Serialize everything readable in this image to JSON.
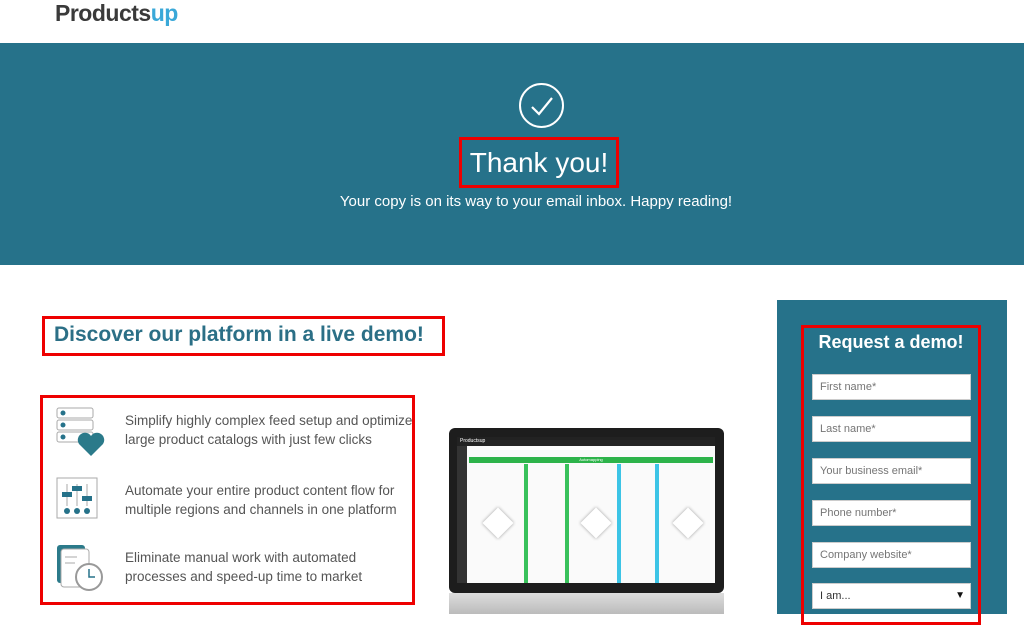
{
  "header": {
    "logo_main": "Products",
    "logo_accent": "up"
  },
  "hero": {
    "icon": "check-circle-icon",
    "title": "Thank you!",
    "subtitle": "Your copy is on its way to your email inbox. Happy reading!",
    "bg_color": "#26728a"
  },
  "main": {
    "heading": "Discover our platform in a live demo!",
    "features": [
      {
        "icon": "feed-setup-heart-icon",
        "text": "Simplify highly complex feed setup and optimize large product catalogs with just few clicks"
      },
      {
        "icon": "sliders-flow-icon",
        "text": "Automate your entire product content flow for multiple regions and channels in one platform"
      },
      {
        "icon": "stopwatch-documents-icon",
        "text": "Eliminate manual work with automated processes and speed-up time to market"
      }
    ],
    "screenshot": {
      "app_logo": "Productsup",
      "banner": "Automapping"
    }
  },
  "form": {
    "title": "Request a demo!",
    "fields": [
      "First name*",
      "Last name*",
      "Your business email*",
      "Phone number*",
      "Company website*"
    ],
    "select_value": "I am..."
  }
}
